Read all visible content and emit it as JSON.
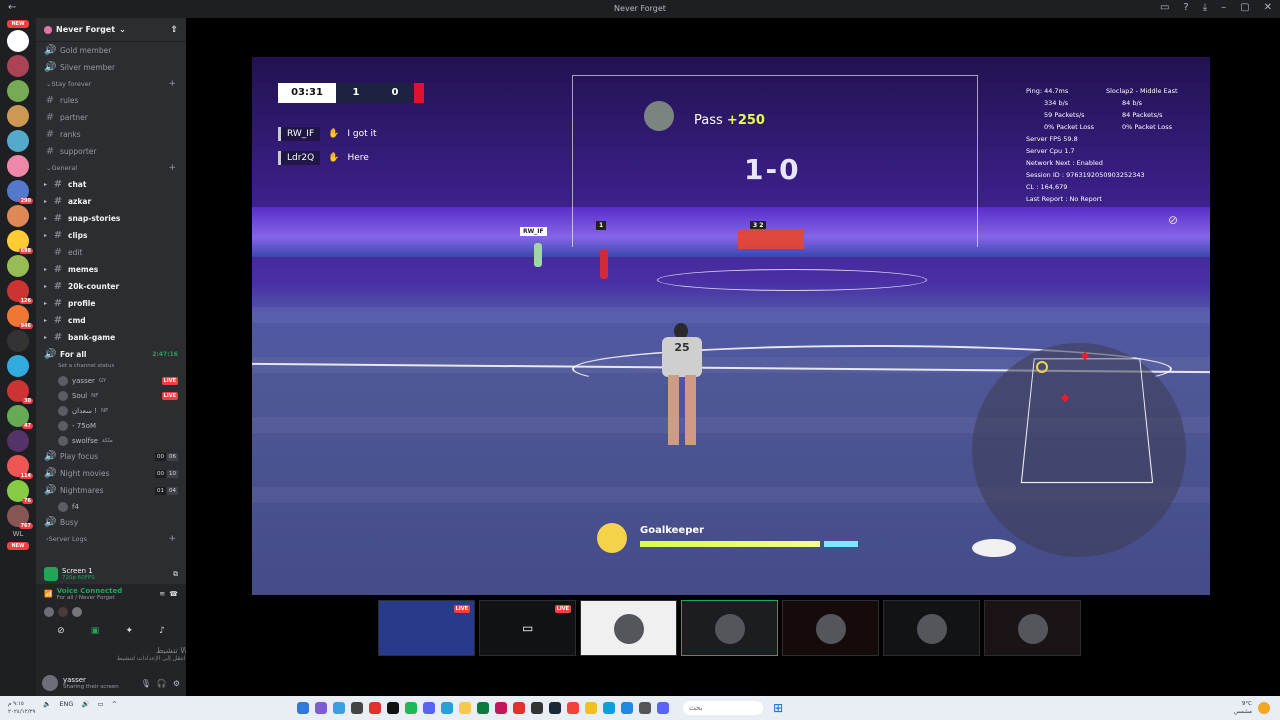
{
  "window": {
    "title": "Never Forget",
    "back_glyph": "←"
  },
  "guilds": {
    "new_tag": "NEW",
    "wl_label": "WL",
    "badges": [
      "",
      "",
      "",
      "",
      "",
      "",
      "290",
      "",
      "698",
      "",
      "126",
      "946",
      "",
      "",
      "30",
      "47",
      "",
      "114",
      "76",
      "767"
    ]
  },
  "server": {
    "name": "Never Forget",
    "invite_glyph": "⇪"
  },
  "channels": {
    "top_items": [
      {
        "label": "Gold member",
        "type": "voice"
      },
      {
        "label": "Silver member",
        "type": "voice"
      }
    ],
    "cat_stay": "Stay forever",
    "stay_items": [
      "rules",
      "partner",
      "ranks",
      "supporter"
    ],
    "cat_general": "General",
    "general_items": [
      {
        "label": "chat",
        "unread": true
      },
      {
        "label": "azkar",
        "unread": true
      },
      {
        "label": "snap-stories",
        "unread": true
      },
      {
        "label": "clips",
        "unread": true
      },
      {
        "label": "edit",
        "unread": false
      },
      {
        "label": "memes",
        "unread": true
      },
      {
        "label": "20k-counter",
        "unread": true
      },
      {
        "label": "profile",
        "unread": true
      },
      {
        "label": "cmd",
        "unread": true
      },
      {
        "label": "bank-game",
        "unread": true
      }
    ],
    "for_all": {
      "label": "For all",
      "timer": "2:47:16",
      "status": "Set a channel status"
    },
    "vc_users": [
      {
        "name": "yasser",
        "tag": "GY",
        "live": "LIVE"
      },
      {
        "name": "Soul",
        "tag": "NF",
        "live": "LIVE"
      },
      {
        "name": "سعدان !",
        "tag": "NF",
        "live": ""
      },
      {
        "name": "- 75oM",
        "tag": "",
        "live": ""
      },
      {
        "name": "swolfse",
        "tag": "ملكة",
        "live": ""
      }
    ],
    "voice_rooms": [
      {
        "label": "Play focus",
        "c1": "00",
        "c2": "06"
      },
      {
        "label": "Night movies",
        "c1": "00",
        "c2": "10"
      },
      {
        "label": "Nightmares",
        "c1": "01",
        "c2": "04"
      }
    ],
    "nightmares_user": "f4",
    "busy": "Busy",
    "server_logs": "Server Logs",
    "new_tag": "NEW"
  },
  "panel": {
    "screen_title": "Screen 1",
    "screen_sub": "720p 60FPS",
    "vc_connected": "Voice Connected",
    "vc_where": "For all / Never Forget",
    "user_name": "yasser",
    "user_status": "Sharing their screen",
    "wm_line1": "تنشيط Windows",
    "wm_line2": "انتقل إلى الإعدادات لتنشيط Windows."
  },
  "game": {
    "clock": "03:31",
    "score_home": "1",
    "score_away": "0",
    "chat": [
      {
        "name": "RW_IF",
        "msg": "I got it"
      },
      {
        "name": "Ldr2Q",
        "msg": "Here"
      }
    ],
    "pass_label": "Pass",
    "pass_points": "+250",
    "big_score": "1-0",
    "tag_rw": "RW_IF",
    "tag_one": "1",
    "tag_32": "3 2",
    "jersey": "25",
    "gk_label": "Goalkeeper",
    "net": {
      "ping": "Ping:  44.7ms",
      "bps_left": "334 b/s",
      "pps_left": "59 Packets/s",
      "loss_left": "0% Packet Loss",
      "server_fps": "Server FPS  59.8",
      "server_cpu": "Server Cpu  1.7",
      "network_next": "Network Next : Enabled",
      "session": "Session ID : 9763192050903252343",
      "cl": "CL : 164,679",
      "last_report": "Last Report : No Report",
      "region": "Sloclap2 - Middle East",
      "bps_right": "84 b/s",
      "pps_right": "84 Packets/s",
      "loss_right": "0% Packet Loss"
    }
  },
  "thumbs": [
    {
      "live": "LIVE"
    },
    {
      "live": "LIVE"
    },
    {
      "live": ""
    },
    {
      "live": ""
    },
    {
      "live": ""
    },
    {
      "live": ""
    },
    {
      "live": ""
    }
  ],
  "taskbar": {
    "lang": "ENG",
    "search_placeholder": "بحث",
    "clock_time": "٩:١٥ م",
    "clock_date": "٢٠٢٤/١٢/٢٩",
    "temp": "9°C",
    "weather_sub": "مشمس"
  },
  "colors": {
    "discord_bg": "#2b2d31",
    "live_red": "#f23f43",
    "accent_green": "#23a559"
  }
}
